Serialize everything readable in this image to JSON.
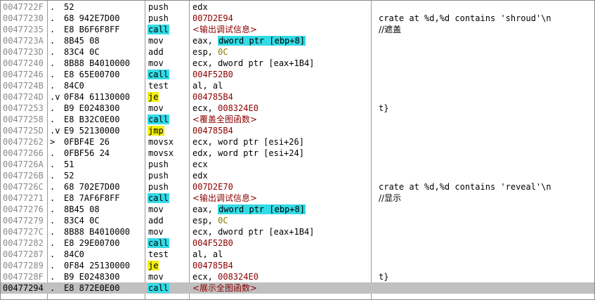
{
  "rows": [
    {
      "addr": "0047722F",
      "mark": ".",
      "hex": "52",
      "mn": "push",
      "ops": [
        {
          "text": "edx",
          "style": "plain"
        }
      ],
      "comment": "",
      "selected": false
    },
    {
      "addr": "00477230",
      "mark": ".",
      "hex": "68 942E7D00",
      "mn": "push",
      "ops": [
        {
          "text": "007D2E94",
          "style": "maroon"
        }
      ],
      "comment": "crate at %d,%d contains 'shroud'\\n",
      "selected": false
    },
    {
      "addr": "00477235",
      "mark": ".",
      "hex": "E8 B6F6F8FF",
      "mn": "call",
      "mn_hl": "cyan",
      "ops": [
        {
          "text": "<输出调试信息>",
          "style": "maroon"
        }
      ],
      "comment": "//遮盖",
      "selected": false
    },
    {
      "addr": "0047723A",
      "mark": ".",
      "hex": "8B45 08",
      "mn": "mov",
      "ops": [
        {
          "text": "eax, ",
          "style": "plain"
        },
        {
          "text": "dword ptr [ebp+8]",
          "style": "cyan"
        }
      ],
      "comment": "",
      "selected": false
    },
    {
      "addr": "0047723D",
      "mark": ".",
      "hex": "83C4 0C",
      "mn": "add",
      "ops": [
        {
          "text": "esp, ",
          "style": "plain"
        },
        {
          "text": "0C",
          "style": "olive"
        }
      ],
      "comment": "",
      "selected": false
    },
    {
      "addr": "00477240",
      "mark": ".",
      "hex": "8B88 B4010000",
      "mn": "mov",
      "ops": [
        {
          "text": "ecx, dword ptr [eax+1B4]",
          "style": "plain"
        }
      ],
      "comment": "",
      "selected": false
    },
    {
      "addr": "00477246",
      "mark": ".",
      "hex": "E8 65E00700",
      "mn": "call",
      "mn_hl": "cyan",
      "ops": [
        {
          "text": "004F52B0",
          "style": "maroon"
        }
      ],
      "comment": "",
      "selected": false
    },
    {
      "addr": "0047724B",
      "mark": ".",
      "hex": "84C0",
      "mn": "test",
      "ops": [
        {
          "text": "al, al",
          "style": "plain"
        }
      ],
      "comment": "",
      "selected": false
    },
    {
      "addr": "0047724D",
      "mark": ".v",
      "hex": "0F84 61130000",
      "mn": "je",
      "mn_hl": "yellow",
      "ops": [
        {
          "text": "004785B4",
          "style": "maroon"
        }
      ],
      "comment": "",
      "selected": false
    },
    {
      "addr": "00477253",
      "mark": ".",
      "hex": "B9 E0248300",
      "mn": "mov",
      "ops": [
        {
          "text": "ecx, ",
          "style": "plain"
        },
        {
          "text": "008324E0",
          "style": "maroon"
        }
      ],
      "comment": "t}",
      "selected": false
    },
    {
      "addr": "00477258",
      "mark": ".",
      "hex": "E8 B32C0E00",
      "mn": "call",
      "mn_hl": "cyan",
      "ops": [
        {
          "text": "<覆盖全图函数>",
          "style": "maroon"
        }
      ],
      "comment": "",
      "selected": false
    },
    {
      "addr": "0047725D",
      "mark": ".v",
      "hex": "E9 52130000",
      "mn": "jmp",
      "mn_hl": "yellow",
      "ops": [
        {
          "text": "004785B4",
          "style": "maroon"
        }
      ],
      "comment": "",
      "selected": false
    },
    {
      "addr": "00477262",
      "mark": ">",
      "hex": "0FBF4E 26",
      "mn": "movsx",
      "ops": [
        {
          "text": "ecx, word ptr [esi+26]",
          "style": "plain"
        }
      ],
      "comment": "",
      "selected": false
    },
    {
      "addr": "00477266",
      "mark": ".",
      "hex": "0FBF56 24",
      "mn": "movsx",
      "ops": [
        {
          "text": "edx, word ptr [esi+24]",
          "style": "plain"
        }
      ],
      "comment": "",
      "selected": false
    },
    {
      "addr": "0047726A",
      "mark": ".",
      "hex": "51",
      "mn": "push",
      "ops": [
        {
          "text": "ecx",
          "style": "plain"
        }
      ],
      "comment": "",
      "selected": false
    },
    {
      "addr": "0047726B",
      "mark": ".",
      "hex": "52",
      "mn": "push",
      "ops": [
        {
          "text": "edx",
          "style": "plain"
        }
      ],
      "comment": "",
      "selected": false
    },
    {
      "addr": "0047726C",
      "mark": ".",
      "hex": "68 702E7D00",
      "mn": "push",
      "ops": [
        {
          "text": "007D2E70",
          "style": "maroon"
        }
      ],
      "comment": "crate at %d,%d contains 'reveal'\\n",
      "selected": false
    },
    {
      "addr": "00477271",
      "mark": ".",
      "hex": "E8 7AF6F8FF",
      "mn": "call",
      "mn_hl": "cyan",
      "ops": [
        {
          "text": "<输出调试信息>",
          "style": "maroon"
        }
      ],
      "comment": "//显示",
      "selected": false
    },
    {
      "addr": "00477276",
      "mark": ".",
      "hex": "8B45 08",
      "mn": "mov",
      "ops": [
        {
          "text": "eax, ",
          "style": "plain"
        },
        {
          "text": "dword ptr [ebp+8]",
          "style": "cyan"
        }
      ],
      "comment": "",
      "selected": false
    },
    {
      "addr": "00477279",
      "mark": ".",
      "hex": "83C4 0C",
      "mn": "add",
      "ops": [
        {
          "text": "esp, ",
          "style": "plain"
        },
        {
          "text": "0C",
          "style": "olive"
        }
      ],
      "comment": "",
      "selected": false
    },
    {
      "addr": "0047727C",
      "mark": ".",
      "hex": "8B88 B4010000",
      "mn": "mov",
      "ops": [
        {
          "text": "ecx, dword ptr [eax+1B4]",
          "style": "plain"
        }
      ],
      "comment": "",
      "selected": false
    },
    {
      "addr": "00477282",
      "mark": ".",
      "hex": "E8 29E00700",
      "mn": "call",
      "mn_hl": "cyan",
      "ops": [
        {
          "text": "004F52B0",
          "style": "maroon"
        }
      ],
      "comment": "",
      "selected": false
    },
    {
      "addr": "00477287",
      "mark": ".",
      "hex": "84C0",
      "mn": "test",
      "ops": [
        {
          "text": "al, al",
          "style": "plain"
        }
      ],
      "comment": "",
      "selected": false
    },
    {
      "addr": "00477289",
      "mark": ".",
      "hex": "0F84 25130000",
      "mn": "je",
      "mn_hl": "yellow",
      "ops": [
        {
          "text": "004785B4",
          "style": "maroon"
        }
      ],
      "comment": "",
      "selected": false
    },
    {
      "addr": "0047728F",
      "mark": ".",
      "hex": "B9 E0248300",
      "mn": "mov",
      "ops": [
        {
          "text": "ecx, ",
          "style": "plain"
        },
        {
          "text": "008324E0",
          "style": "maroon"
        }
      ],
      "comment": "t}",
      "selected": false
    },
    {
      "addr": "00477294",
      "mark": ".",
      "hex": "E8 872E0E00",
      "mn": "call",
      "mn_hl": "cyan",
      "ops": [
        {
          "text": "<展示全图函数>",
          "style": "maroon"
        }
      ],
      "comment": "",
      "selected": true
    }
  ],
  "colors": {
    "cyan": "#33dbe6",
    "yellow": "#f2ee10",
    "maroon": "#8b0000",
    "olive": "#8a7a00",
    "selected": "#c0c0c0"
  }
}
